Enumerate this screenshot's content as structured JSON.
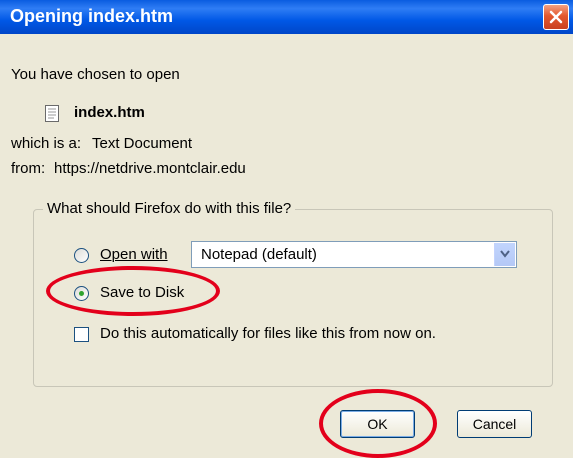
{
  "window": {
    "title": "Opening index.htm"
  },
  "intro": "You have chosen to open",
  "file": {
    "name": "index.htm",
    "type_label": "which is a:",
    "type_value": "Text Document",
    "from_label": "from:",
    "from_value": "https://netdrive.montclair.edu"
  },
  "options": {
    "legend": "What should Firefox do with this file?",
    "open_with_label": "Open with",
    "open_with_app": "Notepad (default)",
    "save_to_disk_label": "Save to Disk",
    "selected": "save_to_disk",
    "auto_label": "Do this automatically for files like this from now on.",
    "auto_checked": false
  },
  "buttons": {
    "ok": "OK",
    "cancel": "Cancel"
  },
  "colors": {
    "title_bar": "#0058e6",
    "dialog_bg": "#ece9d8",
    "annotation": "#e3001b",
    "radio_selected": "#2fa32f"
  }
}
